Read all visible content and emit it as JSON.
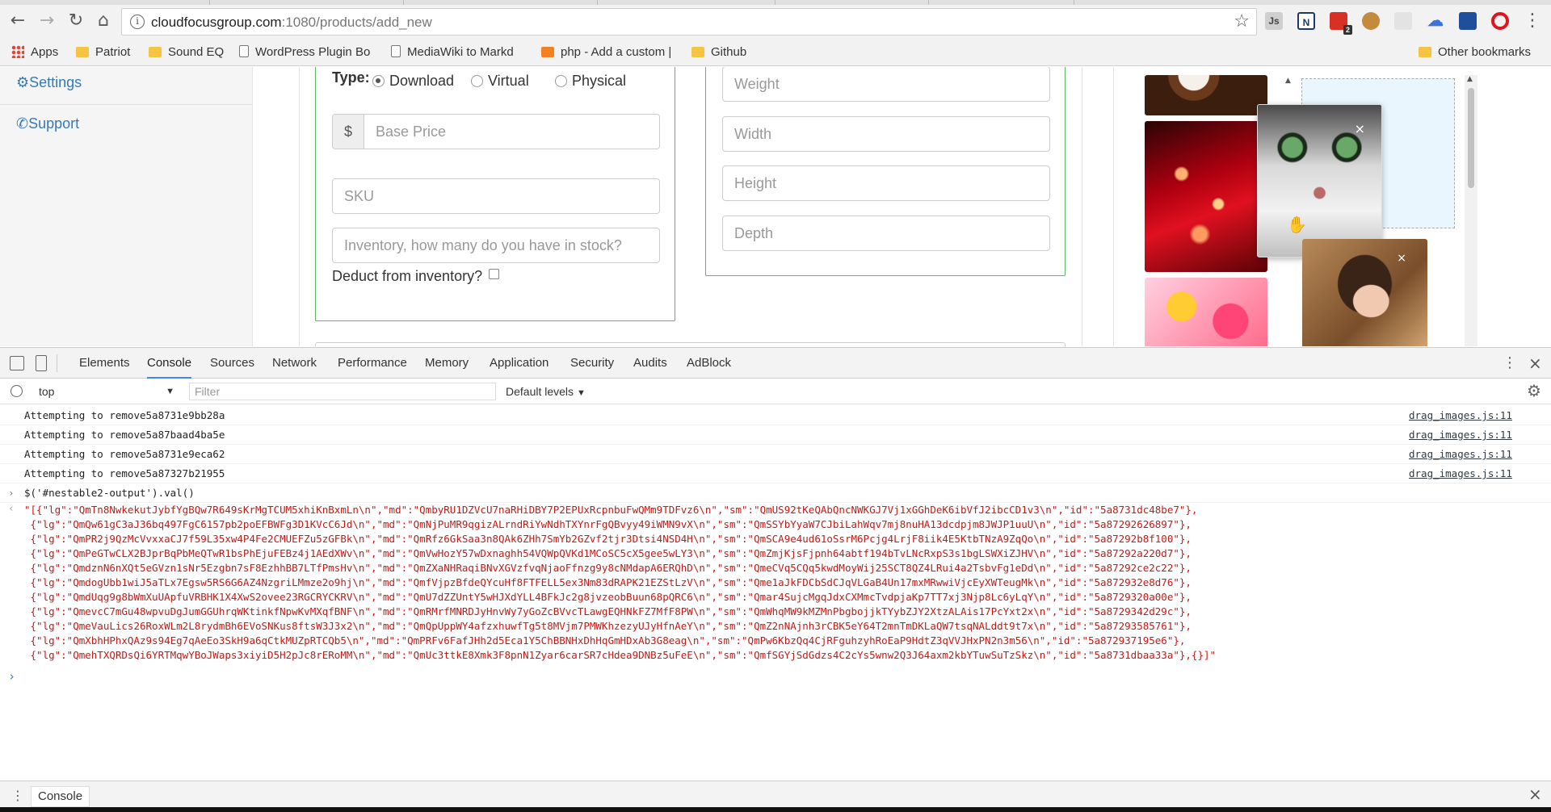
{
  "browser": {
    "url_host": "cloudfocusgroup.com",
    "url_rest": ":1080/products/add_new",
    "ext_badge": "2",
    "bookmarks": [
      "Apps",
      "Patriot",
      "Sound EQ",
      "WordPress Plugin Bo",
      "MediaWiki to Markd",
      "php - Add a custom |",
      "Github"
    ],
    "other_bookmarks": "Other bookmarks"
  },
  "sidebar": {
    "settings": "Settings",
    "support": "Support"
  },
  "product_form": {
    "type_label": "Type:",
    "type_options": [
      "Download",
      "Virtual",
      "Physical"
    ],
    "selected_type": "Download",
    "currency": "$",
    "base_price_placeholder": "Base Price",
    "sku_placeholder": "SKU",
    "inventory_placeholder": "Inventory, how many do you have in stock?",
    "deduct_label": "Deduct from inventory?",
    "weight_placeholder": "Weight",
    "width_placeholder": "Width",
    "height_placeholder": "Height",
    "depth_placeholder": "Depth"
  },
  "devtools": {
    "tabs": [
      "Elements",
      "Console",
      "Sources",
      "Network",
      "Performance",
      "Memory",
      "Application",
      "Security",
      "Audits",
      "AdBlock"
    ],
    "active_tab": "Console",
    "context": "top",
    "filter_placeholder": "Filter",
    "levels": "Default levels",
    "logs": [
      {
        "msg": "Attempting to remove5a8731e9bb28a",
        "src": "drag_images.js:11"
      },
      {
        "msg": "Attempting to remove5a87baad4ba5e",
        "src": "drag_images.js:11"
      },
      {
        "msg": "Attempting to remove5a8731e9eca62",
        "src": "drag_images.js:11"
      },
      {
        "msg": "Attempting to remove5a87327b21955",
        "src": "drag_images.js:11"
      }
    ],
    "command": "$('#nestable2-output').val()",
    "result_lines": [
      "\"[{\"lg\":\"QmTn8NwkekutJybfYgBQw7R649sKrMgTCUM5xhiKnBxmLn\\n\",\"md\":\"QmbyRU1DZVcU7naRHiDBY7P2EPUxRcpnbuFwQMm9TDFvz6\\n\",\"sm\":\"QmUS92tKeQAbQncNWKGJ7Vj1xGGhDeK6ibVfJ2ibcCD1v3\\n\",\"id\":\"5a8731dc48be7\"},",
      " {\"lg\":\"QmQw61gC3aJ36bq497FgC6157pb2poEFBWFg3D1KVcC6Jd\\n\",\"md\":\"QmNjPuMR9qgizALrndRiYwNdhTXYnrFgQBvyy49iWMN9vX\\n\",\"sm\":\"QmSSYbYyaW7CJbiLahWqv7mj8nuHA13dcdpjm8JWJP1uuU\\n\",\"id\":\"5a87292626897\"},",
      " {\"lg\":\"QmPR2j9QzMcVvxxaCJ7f59L35xw4P4Fe2CMUEFZu5zGFBk\\n\",\"md\":\"QmRfz6GkSaa3n8QAk6ZHh7SmYb2GZvf2tjr3Dtsi4NSD4H\\n\",\"sm\":\"QmSCA9e4ud61oSsrM6Pcjg4LrjF8iik4E5KtbTNzA9ZqQo\\n\",\"id\":\"5a87292b8f100\"},",
      " {\"lg\":\"QmPeGTwCLX2BJprBqPbMeQTwR1bsPhEjuFEBz4j1AEdXWv\\n\",\"md\":\"QmVwHozY57wDxnaghh54VQWpQVKd1MCoSC5cX5gee5wLY3\\n\",\"sm\":\"QmZmjKjsFjpnh64abtf194bTvLNcRxpS3s1bgLSWXiZJHV\\n\",\"id\":\"5a87292a220d7\"},",
      " {\"lg\":\"QmdznN6nXQt5eGVzn1sNr5Ezgbn7sF8EzhhBB7LTfPmsHv\\n\",\"md\":\"QmZXaNHRaqiBNvXGVzfvqNjaoFfnzg9y8cNMdapA6ERQhD\\n\",\"sm\":\"QmeCVq5CQq5kwdMoyWij25SCT8QZ4LRui4a2TsbvFg1eDd\\n\",\"id\":\"5a87292ce2c22\"},",
      " {\"lg\":\"QmdogUbb1wiJ5aTLx7Egsw5RS6G6AZ4NzgriLMmze2o9hj\\n\",\"md\":\"QmfVjpzBfdeQYcuHf8FTFELL5ex3Nm83dRAPK21EZStLzV\\n\",\"sm\":\"Qme1aJkFDCbSdCJqVLGaB4Un17mxMRwwiVjcEyXWTeugMk\\n\",\"id\":\"5a872932e8d76\"},",
      " {\"lg\":\"QmdUqg9g8bWmXuUApfuVRBHK1X4XwS2ovee23RGCRYCKRV\\n\",\"md\":\"QmU7dZZUntY5wHJXdYLL4BFkJc2g8jvzeobBuun68pQRC6\\n\",\"sm\":\"Qmar4SujcMgqJdxCXMmcTvdpjaKp7TT7xj3Njp8Lc6yLqY\\n\",\"id\":\"5a8729320a00e\"},",
      " {\"lg\":\"QmevcC7mGu48wpvuDgJumGGUhrqWKtinkfNpwKvMXqfBNF\\n\",\"md\":\"QmRMrfMNRDJyHnvWy7yGoZcBVvcTLawgEQHNkFZ7MfF8PW\\n\",\"sm\":\"QmWhqMW9kMZMnPbgbojjkTYybZJY2XtzALAis17PcYxt2x\\n\",\"id\":\"5a8729342d29c\"},",
      " {\"lg\":\"QmeVauLics26RoxWLm2L8rydmBh6EVoSNKus8ftsW3J3x2\\n\",\"md\":\"QmQpUppWY4afzxhuwfTg5t8MVjm7PMWKhzezyUJyHfnAeY\\n\",\"sm\":\"QmZ2nNAjnh3rCBK5eY64T2mnTmDKLaQW7tsqNALddt9t7x\\n\",\"id\":\"5a87293585761\"},",
      " {\"lg\":\"QmXbhHPhxQAz9s94Eg7qAeEo3SkH9a6qCtkMUZpRTCQb5\\n\",\"md\":\"QmPRFv6FafJHh2d5Eca1Y5ChBBNHxDhHqGmHDxAb3G8eag\\n\",\"sm\":\"QmPw6KbzQq4CjRFguhzyhRoEaP9HdtZ3qVVJHxPN2n3m56\\n\",\"id\":\"5a872937195e6\"},",
      " {\"lg\":\"QmehTXQRDsQi6YRTMqwYBoJWaps3xiyiD5H2pJc8rERoMM\\n\",\"md\":\"QmUc3ttkE8Xmk3F8pnN1Zyar6carSR7cHdea9DNBz5uFeE\\n\",\"sm\":\"QmfSGYjSdGdzs4C2cYs5wnw2Q3J64axm2kbYTuwSuTzSkz\\n\",\"id\":\"5a8731dbaa33a\"},{}]\""
    ],
    "drawer_tab": "Console"
  }
}
